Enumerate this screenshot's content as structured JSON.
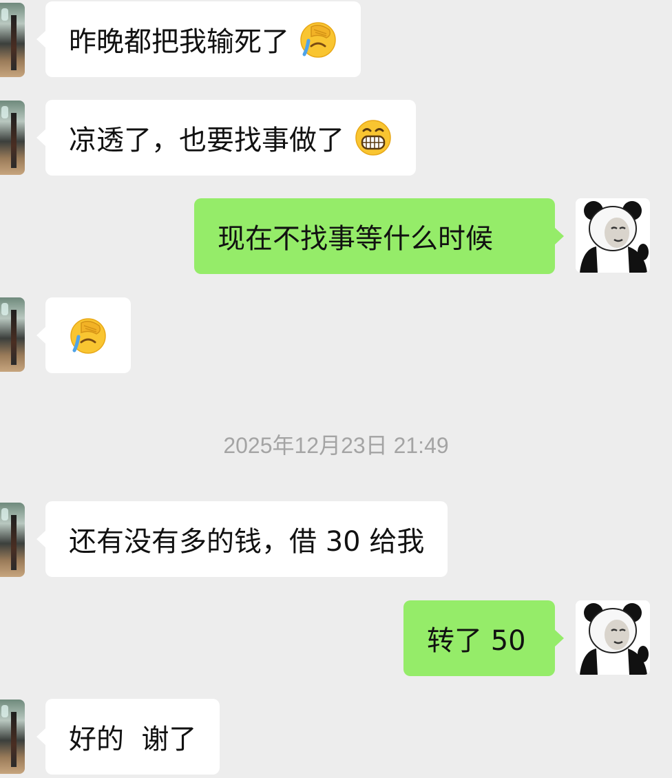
{
  "timestamp": "2025年12月23日 21:49",
  "messages": [
    {
      "side": "in",
      "text": "昨晚都把我输死了",
      "emoji": "facepalm-crying-emoji"
    },
    {
      "side": "in",
      "text": "凉透了，也要找事做了",
      "emoji": "grinning-teeth-emoji"
    },
    {
      "side": "out",
      "text": "现在不找事等什么时候"
    },
    {
      "side": "in",
      "text": "",
      "emoji": "facepalm-crying-emoji"
    },
    {
      "side": "in",
      "text": "还有没有多的钱，借 30 给我"
    },
    {
      "side": "out",
      "text": "转了 50"
    },
    {
      "side": "in",
      "text": "好的  谢了"
    }
  ],
  "colors": {
    "background": "#ededed",
    "incoming_bubble": "#ffffff",
    "outgoing_bubble": "#95ec69",
    "timestamp_text": "#a4a4a4"
  }
}
